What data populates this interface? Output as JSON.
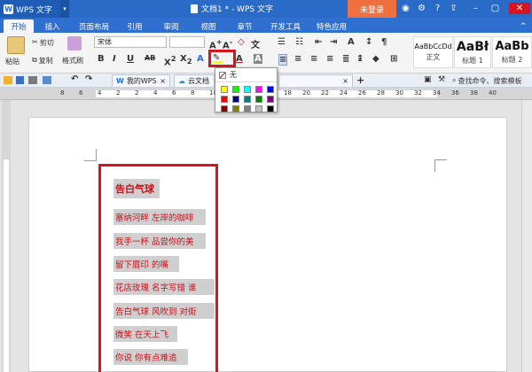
{
  "app": {
    "name": "WPS 文字",
    "doc_title": "文档1 * - WPS 文字",
    "login": "未登录"
  },
  "menu": [
    "开始",
    "插入",
    "页面布局",
    "引用",
    "审阅",
    "视图",
    "章节",
    "开发工具",
    "特色应用"
  ],
  "ribbon": {
    "paste": "粘贴",
    "cut": "剪切",
    "copy": "复制",
    "format_painter": "格式刷",
    "font_name": "宋体",
    "styles": [
      {
        "preview": "AaBbCcDd",
        "name": "正文"
      },
      {
        "preview": "AaBł",
        "name": "标题 1"
      },
      {
        "preview": "AaBb",
        "name": "标题 2"
      }
    ]
  },
  "tabs": [
    {
      "label": "我的WPS"
    },
    {
      "label": "云文档"
    }
  ],
  "search_placeholder": "查找命令、搜索模板",
  "ruler_numbers": [
    "8",
    "6",
    "4",
    "2",
    "2",
    "4",
    "6",
    "8",
    "10",
    "12",
    "14",
    "16",
    "18",
    "20",
    "22",
    "24",
    "26",
    "28",
    "30",
    "32",
    "34",
    "36",
    "38",
    "40"
  ],
  "highlight_popup": {
    "none_label": "无",
    "colors": [
      "#ffff00",
      "#00ff00",
      "#00ffff",
      "#ff00ff",
      "#0000ff",
      "#ff0000",
      "#000080",
      "#008080",
      "#008000",
      "#800080",
      "#800000",
      "#808000",
      "#808080",
      "#c0c0c0",
      "#000000"
    ]
  },
  "document": {
    "lines": [
      {
        "text": "告白气球",
        "width": 52,
        "bold": true
      },
      {
        "text": "塞纳河畔 左岸的咖啡",
        "width": 104
      },
      {
        "text": "我手一杯 品尝你的美",
        "width": 104
      },
      {
        "text": "留下唇印 的嘴",
        "width": 74
      },
      {
        "text": "花店玫瑰 名字写错 谁",
        "width": 114
      },
      {
        "text": "告白气球 风吹到 对街",
        "width": 114
      },
      {
        "text": "微笑 在天上飞",
        "width": 72
      },
      {
        "text": "你说 你有点难追",
        "width": 84
      }
    ]
  },
  "colors": {
    "titlebar": "#2b6bc8",
    "accent_red": "#d8151f",
    "text_red": "#c4121a",
    "login_bg": "#ef6f3f"
  }
}
